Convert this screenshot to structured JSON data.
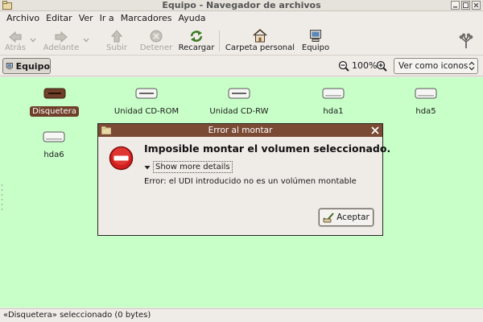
{
  "window": {
    "title": "Equipo - Navegador de archivos"
  },
  "menubar": {
    "items": [
      {
        "label": "Archivo"
      },
      {
        "label": "Editar"
      },
      {
        "label": "Ver"
      },
      {
        "label": "Ir a"
      },
      {
        "label": "Marcadores"
      },
      {
        "label": "Ayuda"
      }
    ]
  },
  "toolbar": {
    "back_label": "Atrás",
    "forward_label": "Adelante",
    "up_label": "Subir",
    "stop_label": "Detener",
    "reload_label": "Recargar",
    "home_label": "Carpeta personal",
    "computer_label": "Equipo"
  },
  "location": {
    "button_label": "Equipo",
    "zoom": "100%",
    "view_mode": "Ver como iconos"
  },
  "icons": [
    {
      "label": "Disquetera",
      "icon": "floppy-drive-icon",
      "selected": true
    },
    {
      "label": "Unidad CD-ROM",
      "icon": "cdrom-drive-icon",
      "selected": false
    },
    {
      "label": "Unidad CD-RW",
      "icon": "cdrw-drive-icon",
      "selected": false
    },
    {
      "label": "hda1",
      "icon": "hard-disk-icon",
      "selected": false
    },
    {
      "label": "hda5",
      "icon": "hard-disk-icon",
      "selected": false
    },
    {
      "label": "hda6",
      "icon": "hard-disk-icon",
      "selected": false
    }
  ],
  "dialog": {
    "title": "Error al montar",
    "heading": "Imposible montar el volumen seleccionado.",
    "details_label": "Show more details",
    "message": "Error: el UDI introducido no es un volúmen montable",
    "ok_label": "Aceptar"
  },
  "status": {
    "text": "«Disquetera» seleccionado (0 bytes)"
  },
  "colors": {
    "icon_area_bg": "#c8ffc8",
    "selection": "#6f3f2a",
    "dialog_title": "#7a4a34",
    "error_red": "#d21e1e"
  }
}
